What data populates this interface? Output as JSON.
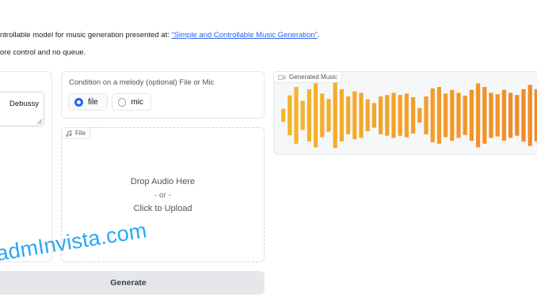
{
  "intro": {
    "line1_prefix": "ntrollable model for music generation presented at: ",
    "line1_link": "“Simple and Controllable Music Generation”",
    "line1_suffix": ".",
    "line2": "ore control and no queue."
  },
  "left": {
    "prompt_value": "Debussy"
  },
  "condition": {
    "label": "Condition on a melody (optional) File or Mic",
    "options": [
      "file",
      "mic"
    ],
    "selected": "file"
  },
  "file_block": {
    "label": "File",
    "drop_text": "Drop Audio Here",
    "or_text": "- or -",
    "upload_text": "Click to Upload"
  },
  "output": {
    "label": "Generated Music",
    "waveform_levels": [
      0.18,
      0.55,
      0.78,
      0.4,
      0.72,
      0.88,
      0.6,
      0.45,
      0.9,
      0.72,
      0.52,
      0.66,
      0.62,
      0.44,
      0.34,
      0.52,
      0.56,
      0.62,
      0.56,
      0.6,
      0.5,
      0.2,
      0.52,
      0.74,
      0.78,
      0.6,
      0.7,
      0.62,
      0.54,
      0.7,
      0.88,
      0.78,
      0.62,
      0.58,
      0.7,
      0.62,
      0.56,
      0.72,
      0.84,
      0.72
    ],
    "colors": {
      "start": "#f5b52e",
      "end": "#f08a24"
    }
  },
  "buttons": {
    "generate_label": "Generate"
  },
  "watermark": "admInvista.com"
}
